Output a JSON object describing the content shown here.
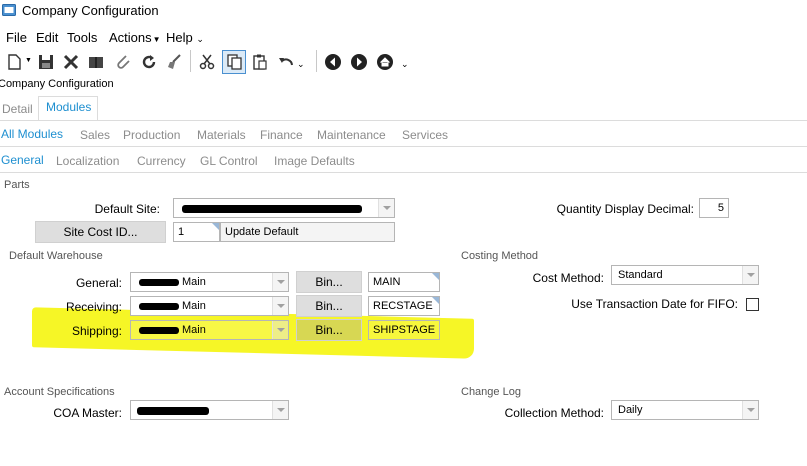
{
  "window": {
    "title": "Company Configuration"
  },
  "menu": {
    "items": [
      "File",
      "Edit",
      "Tools",
      "Actions",
      "Help"
    ]
  },
  "toolbar": {
    "icons": [
      "new-icon",
      "save-icon",
      "delete-icon",
      "book-icon",
      "attach-icon",
      "refresh-icon",
      "clear-icon",
      "cut-icon",
      "copy-icon",
      "paste-icon",
      "undo-icon",
      "previous-icon",
      "next-icon",
      "home-icon"
    ]
  },
  "breadcrumb": "Company Configuration",
  "tabs": {
    "top": [
      "Detail",
      "Modules"
    ],
    "modules": [
      "All Modules",
      "Sales",
      "Production",
      "Materials",
      "Finance",
      "Maintenance",
      "Services"
    ],
    "sub": [
      "General",
      "Localization",
      "Currency",
      "GL Control",
      "Image Defaults"
    ]
  },
  "parts": {
    "header": "Parts",
    "default_site_label": "Default Site:",
    "site_cost_button": "Site Cost ID...",
    "site_cost_value": "1",
    "update_default_button": "Update Default",
    "qty_decimal_label": "Quantity Display Decimal:",
    "qty_decimal_value": "5"
  },
  "warehouse": {
    "header": "Default Warehouse",
    "rows": [
      {
        "label": "General:",
        "warehouse": "Main",
        "bin_button": "Bin...",
        "bin": "MAIN"
      },
      {
        "label": "Receiving:",
        "warehouse": "Main",
        "bin_button": "Bin...",
        "bin": "RECSTAGE"
      },
      {
        "label": "Shipping:",
        "warehouse": "Main",
        "bin_button": "Bin...",
        "bin": "SHIPSTAGE"
      }
    ]
  },
  "costing": {
    "header": "Costing Method",
    "cost_method_label": "Cost Method:",
    "cost_method_value": "Standard",
    "fifo_label": "Use Transaction Date for FIFO:",
    "fifo_checked": false
  },
  "account": {
    "header": "Account Specifications",
    "coa_label": "COA Master:"
  },
  "changelog": {
    "header": "Change Log",
    "collection_label": "Collection Method:",
    "collection_value": "Daily"
  },
  "colors": {
    "tab_active": "#1e8fd0",
    "highlight": "#f5f500"
  }
}
